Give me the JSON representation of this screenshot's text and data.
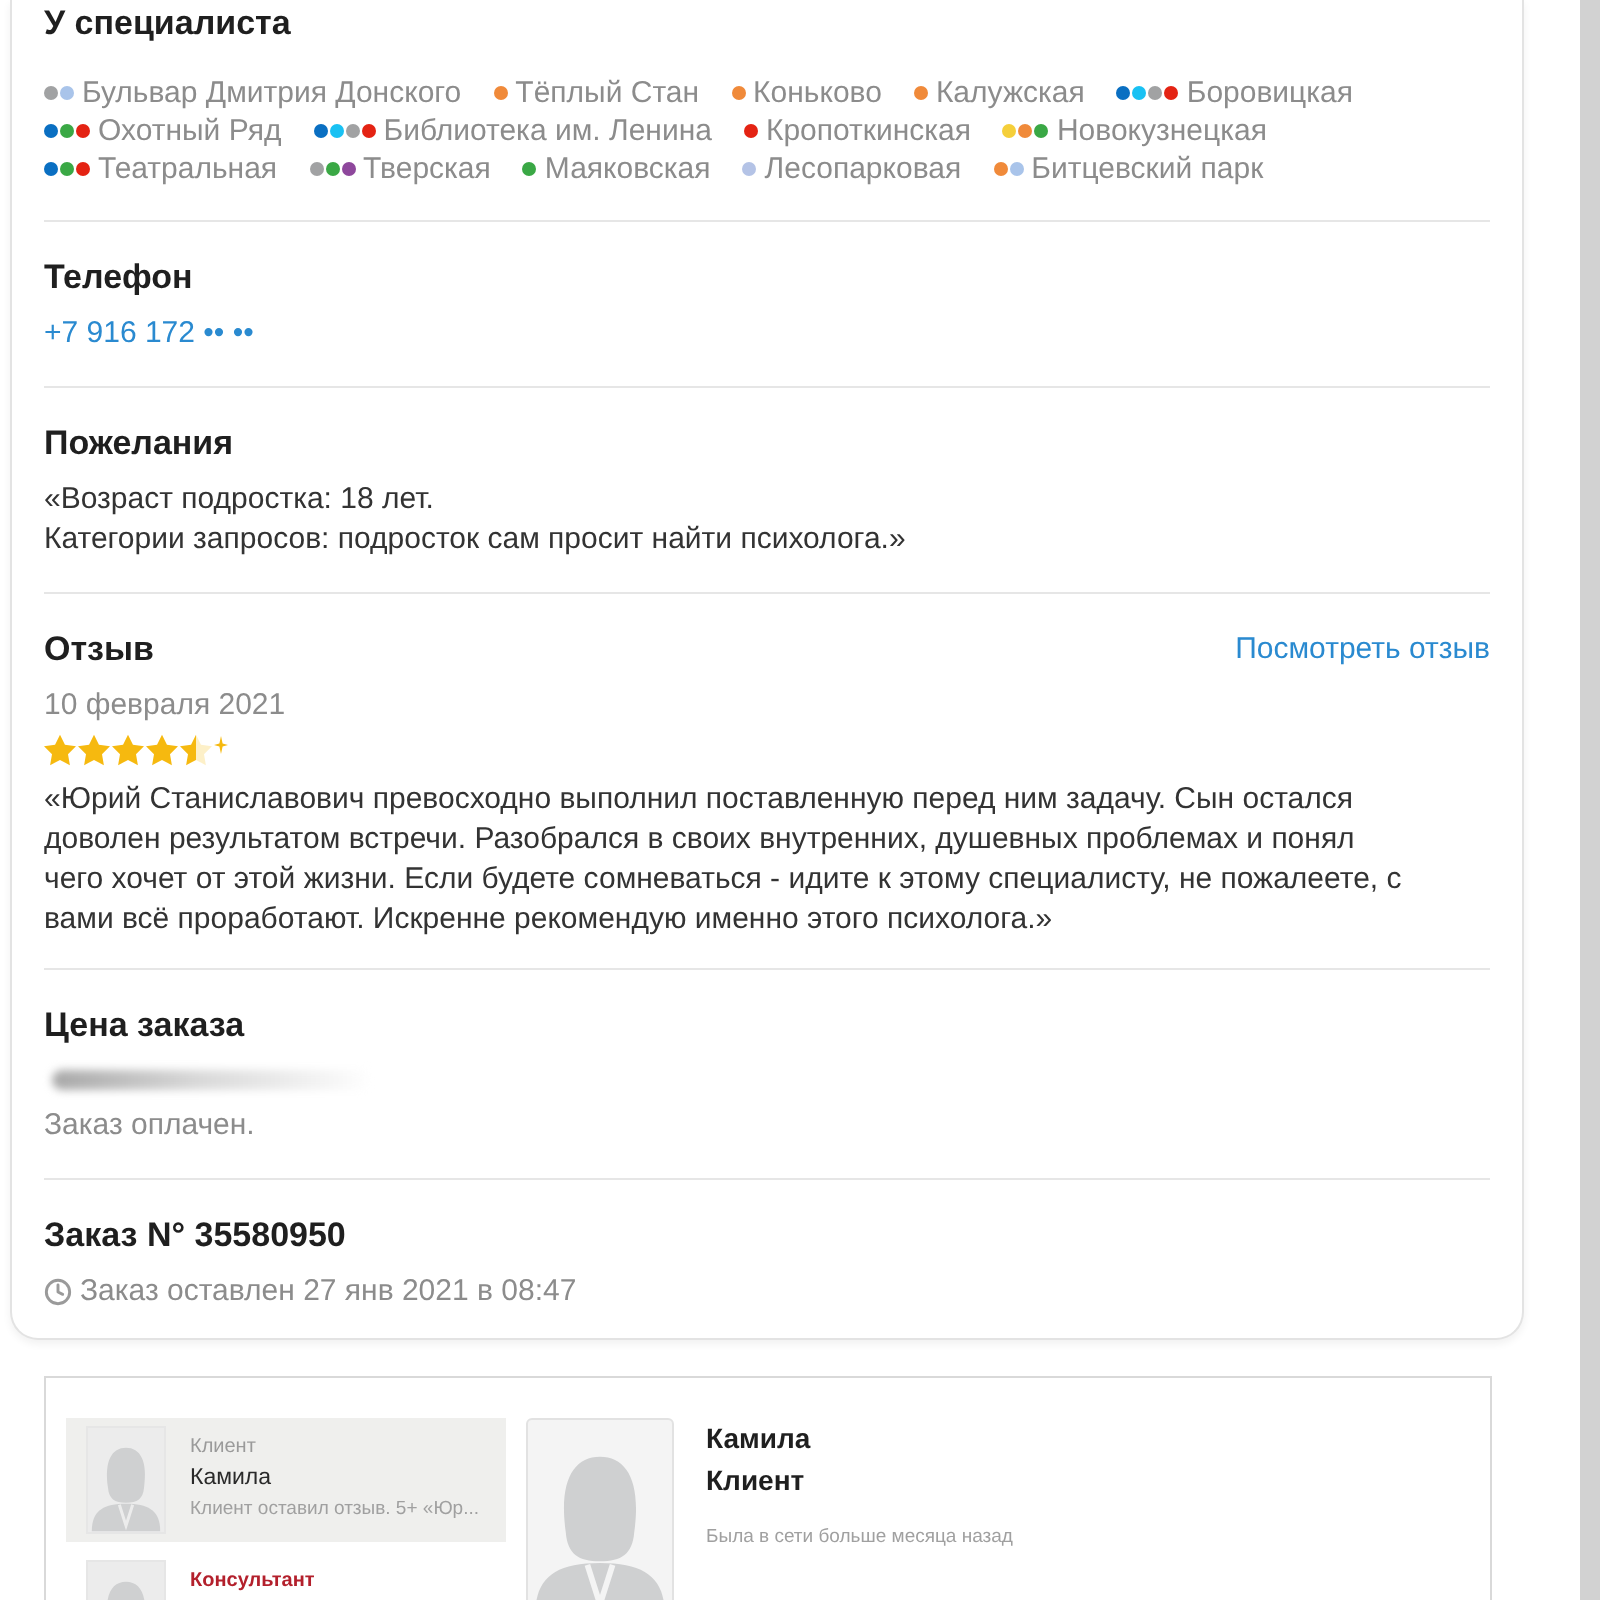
{
  "specialist_stations": {
    "title": "У специалиста",
    "stations": [
      {
        "name": "Бульвар Дмитрия Донского",
        "lines": [
          {
            "color": "#a1a2a3"
          },
          {
            "color": "#a9c4ea"
          }
        ]
      },
      {
        "name": "Тёплый Стан",
        "lines": [
          {
            "color": "#f08a3a"
          }
        ]
      },
      {
        "name": "Коньково",
        "lines": [
          {
            "color": "#f08a3a"
          }
        ]
      },
      {
        "name": "Калужская",
        "lines": [
          {
            "color": "#f08a3a"
          }
        ]
      },
      {
        "name": "Боровицкая",
        "lines": [
          {
            "color": "#0a6fc2"
          },
          {
            "color": "#19c1f3"
          },
          {
            "color": "#a1a2a3"
          },
          {
            "color": "#e42313"
          }
        ]
      },
      {
        "name": "Охотный Ряд",
        "lines": [
          {
            "color": "#0a6fc2"
          },
          {
            "color": "#3aa845"
          },
          {
            "color": "#e42313"
          }
        ]
      },
      {
        "name": "Библиотека им. Ленина",
        "lines": [
          {
            "color": "#0a6fc2"
          },
          {
            "color": "#19c1f3"
          },
          {
            "color": "#a1a2a3"
          },
          {
            "color": "#e42313"
          }
        ]
      },
      {
        "name": "Кропоткинская",
        "lines": [
          {
            "color": "#e42313"
          }
        ]
      },
      {
        "name": "Новокузнецкая",
        "lines": [
          {
            "color": "#f5cf3a"
          },
          {
            "color": "#f08a3a"
          },
          {
            "color": "#3aa845"
          }
        ]
      },
      {
        "name": "Театральная",
        "lines": [
          {
            "color": "#0a6fc2"
          },
          {
            "color": "#3aa845"
          },
          {
            "color": "#e42313"
          }
        ]
      },
      {
        "name": "Тверская",
        "lines": [
          {
            "color": "#a1a2a3"
          },
          {
            "color": "#3aa845"
          },
          {
            "color": "#8e479c"
          }
        ]
      },
      {
        "name": "Маяковская",
        "lines": [
          {
            "color": "#3aa845"
          }
        ]
      },
      {
        "name": "Лесопарковая",
        "lines": [
          {
            "color": "#b4c3e6"
          }
        ]
      },
      {
        "name": "Битцевский парк",
        "lines": [
          {
            "color": "#f08a3a"
          },
          {
            "color": "#a9c4ea"
          }
        ]
      }
    ]
  },
  "phone": {
    "title": "Телефон",
    "number": "+7 916 172 •• ••"
  },
  "wishes": {
    "title": "Пожелания",
    "text": "«Возраст подростка: 18 лет.\nКатегории запросов: подросток сам просит найти психолога.»"
  },
  "review": {
    "title": "Отзыв",
    "link": "Посмотреть отзыв",
    "date": "10 февраля 2021",
    "stars": 4.5,
    "text": "«Юрий Станиславович превосходно выполнил поставленную перед ним задачу. Сын остался доволен результатом встречи. Разобрался в своих внутренних, душевных проблемах и понял чего хочет от этой жизни. Если будете сомневаться - идите к этому специалисту, не пожалеете, с вами всё проработают. Искренне рекомендую именно этого психолога.»"
  },
  "price": {
    "title": "Цена заказа",
    "status": "Заказ оплачен."
  },
  "order": {
    "title": "Заказ N° 35580950",
    "created": "Заказ оставлен 27 янв 2021 в 08:47"
  },
  "chat": {
    "conversations": [
      {
        "kind": "client",
        "role": "Клиент",
        "name": "Камила",
        "preview": "Клиент оставил отзыв. 5+ «Юр...",
        "selected": true
      },
      {
        "kind": "consultant",
        "role": "Консультант",
        "selected": false
      }
    ],
    "profile": {
      "name": "Камила",
      "role": "Клиент",
      "status": "Была в сети больше месяца назад"
    }
  }
}
